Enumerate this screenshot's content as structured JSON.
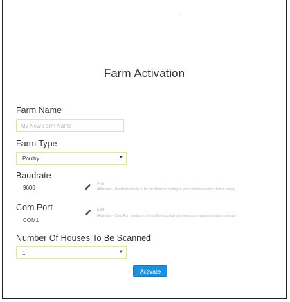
{
  "page": {
    "title": "Farm Activation"
  },
  "form": {
    "farm_name": {
      "label": "Farm Name",
      "value": "",
      "placeholder": "My New Farm Name"
    },
    "farm_type": {
      "label": "Farm Type",
      "selected": "Poultry"
    },
    "baudrate": {
      "label": "Baudrate",
      "value": "9600",
      "edit_label": "Edit",
      "attention": "(Attention - Baudrate needs to be modified according to your communication device setup)"
    },
    "com_port": {
      "label": "Com Port",
      "value": "COM1",
      "edit_label": "Edit",
      "attention": "(Attention - Com Port needs to be modified according to your communication device setup)"
    },
    "houses": {
      "label": "Number Of Houses To Be Scanned",
      "selected": "1"
    },
    "activate_label": "Activate"
  },
  "icons": {
    "edit": "pencil-icon",
    "dropdown": "caret-down-icon"
  },
  "colors": {
    "accent": "#1b8fe0",
    "input_border": "#e6e0b8",
    "muted_text": "#bbbbbb"
  }
}
